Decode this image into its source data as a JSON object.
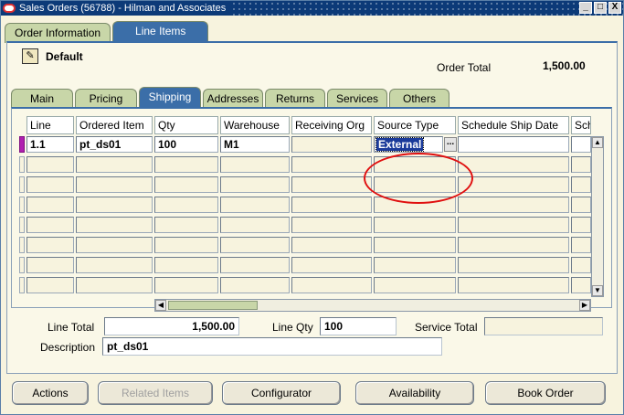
{
  "window": {
    "title": "Sales Orders (56788) - Hilman and Associates",
    "controls": [
      "_",
      "□",
      "X"
    ]
  },
  "top_tabs": [
    {
      "label": "Order Information",
      "active": false
    },
    {
      "label": "Line Items",
      "active": true
    }
  ],
  "header": {
    "default_label": "Default",
    "order_total_label": "Order Total",
    "order_total_value": "1,500.00"
  },
  "sub_tabs": [
    {
      "label": "Main",
      "active": false
    },
    {
      "label": "Pricing",
      "active": false
    },
    {
      "label": "Shipping",
      "active": true
    },
    {
      "label": "Addresses",
      "active": false
    },
    {
      "label": "Returns",
      "active": false
    },
    {
      "label": "Services",
      "active": false
    },
    {
      "label": "Others",
      "active": false
    }
  ],
  "grid": {
    "columns": [
      "Line",
      "Ordered Item",
      "Qty",
      "Warehouse",
      "Receiving Org",
      "Source Type",
      "Schedule Ship Date",
      "Sch"
    ],
    "rows": [
      {
        "line": "1.1",
        "ordered_item": "pt_ds01",
        "qty": "100",
        "warehouse": "M1",
        "receiving_org": "",
        "source_type": "External",
        "schedule_ship_date": "",
        "sch": ""
      }
    ],
    "empty_rows": 7,
    "lov_button": "..."
  },
  "footer": {
    "line_total_label": "Line Total",
    "line_total_value": "1,500.00",
    "line_qty_label": "Line Qty",
    "line_qty_value": "100",
    "service_total_label": "Service Total",
    "service_total_value": "",
    "description_label": "Description",
    "description_value": "pt_ds01"
  },
  "buttons": {
    "actions": "Actions",
    "related_items": "Related Items",
    "configurator": "Configurator",
    "availability": "Availability",
    "book_order": "Book Order"
  },
  "colors": {
    "accent": "#3b6ea8",
    "highlight_circle": "#e01010",
    "selection": "#1a3a9a"
  }
}
